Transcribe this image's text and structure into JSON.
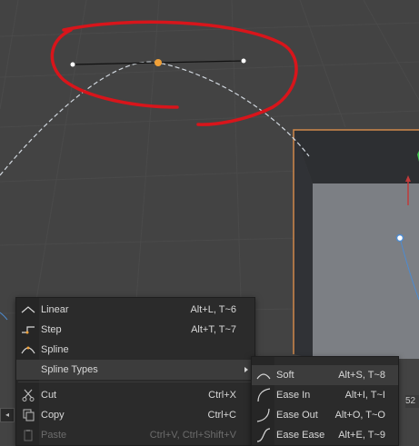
{
  "main_menu": {
    "items": [
      {
        "label": "Linear",
        "shortcut": "Alt+L, T~6",
        "icon": "linear-curve-icon"
      },
      {
        "label": "Step",
        "shortcut": "Alt+T, T~7",
        "icon": "step-curve-icon"
      },
      {
        "label": "Spline",
        "shortcut": "",
        "icon": "spline-curve-icon"
      },
      {
        "label": "Spline Types",
        "shortcut": "",
        "icon": ""
      },
      {
        "label": "Cut",
        "shortcut": "Ctrl+X",
        "icon": "scissors-icon"
      },
      {
        "label": "Copy",
        "shortcut": "Ctrl+C",
        "icon": "copy-icon"
      },
      {
        "label": "Paste",
        "shortcut": "Ctrl+V, Ctrl+Shift+V",
        "icon": "paste-icon"
      }
    ]
  },
  "sub_menu": {
    "items": [
      {
        "label": "Soft",
        "shortcut": "Alt+S, T~8",
        "icon": "soft-curve-icon"
      },
      {
        "label": "Ease In",
        "shortcut": "Alt+I, T~I",
        "icon": "ease-in-icon"
      },
      {
        "label": "Ease Out",
        "shortcut": "Alt+O, T~O",
        "icon": "ease-out-icon"
      },
      {
        "label": "Ease Ease",
        "shortcut": "Alt+E, T~9",
        "icon": "ease-ease-icon"
      }
    ]
  },
  "side_number": "52",
  "colors": {
    "annotation": "#d8151b",
    "key_selected": "#f0a038",
    "object_edge": "#d0884a",
    "viewport_bg": "#434343"
  }
}
